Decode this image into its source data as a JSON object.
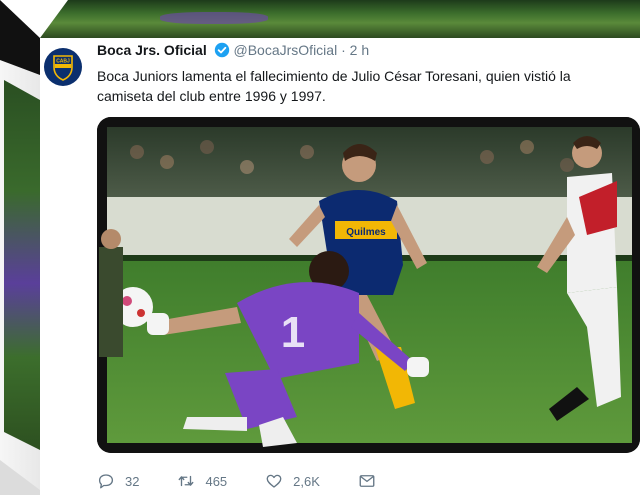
{
  "tweet": {
    "display_name": "Boca Jrs. Oficial",
    "handle": "@BocaJrsOficial",
    "separator": "·",
    "time": "2 h",
    "text": "Boca Juniors lamenta el fallecimiento de Julio César Toresani, quien vistió la camiseta del club entre 1996 y 1997.",
    "avatar_badge": "CABJ",
    "shirt_sponsor": "Quilmes",
    "goalkeeper_number": "1"
  },
  "actions": {
    "replies": "32",
    "retweets": "465",
    "likes": "2,6K"
  },
  "icons": {
    "reply": "reply-icon",
    "retweet": "retweet-icon",
    "like": "heart-icon",
    "message": "message-icon",
    "verified": "verified-badge-icon"
  },
  "colors": {
    "brand_blue": "#0b2f6e",
    "brand_gold": "#f2b705",
    "verified": "#1da1f2",
    "muted": "#657786"
  }
}
